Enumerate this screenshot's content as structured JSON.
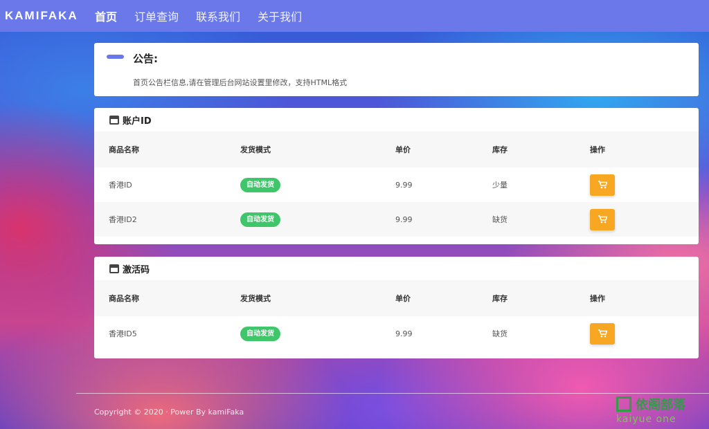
{
  "header": {
    "brand": "KAMIFAKA",
    "nav": [
      {
        "label": "首页",
        "active": true
      },
      {
        "label": "订单查询",
        "active": false
      },
      {
        "label": "联系我们",
        "active": false
      },
      {
        "label": "关于我们",
        "active": false
      }
    ]
  },
  "notice": {
    "title": "公告:",
    "text": "首页公告栏信息,请在管理后台网站设置里修改，支持HTML格式"
  },
  "table_columns": [
    "商品名称",
    "发货模式",
    "单价",
    "库存",
    "操作"
  ],
  "categories": [
    {
      "name": "账户ID",
      "icon": "store-icon",
      "products": [
        {
          "name": "香港ID",
          "mode": "自动发货",
          "price": "9.99",
          "stock": "少量"
        },
        {
          "name": "香港ID2",
          "mode": "自动发货",
          "price": "9.99",
          "stock": "缺货"
        }
      ]
    },
    {
      "name": "激活码",
      "icon": "store-icon",
      "products": [
        {
          "name": "香港ID5",
          "mode": "自动发货",
          "price": "9.99",
          "stock": "缺货"
        }
      ]
    }
  ],
  "footer": {
    "copyright": "Copyright © 2020 · Power By kamiFaka"
  },
  "watermark": {
    "cn": "依阁部落",
    "en": "kaiyue one"
  },
  "colors": {
    "accent": "#6a78ea",
    "badge": "#3fc66a",
    "buy_button": "#f8a722"
  }
}
